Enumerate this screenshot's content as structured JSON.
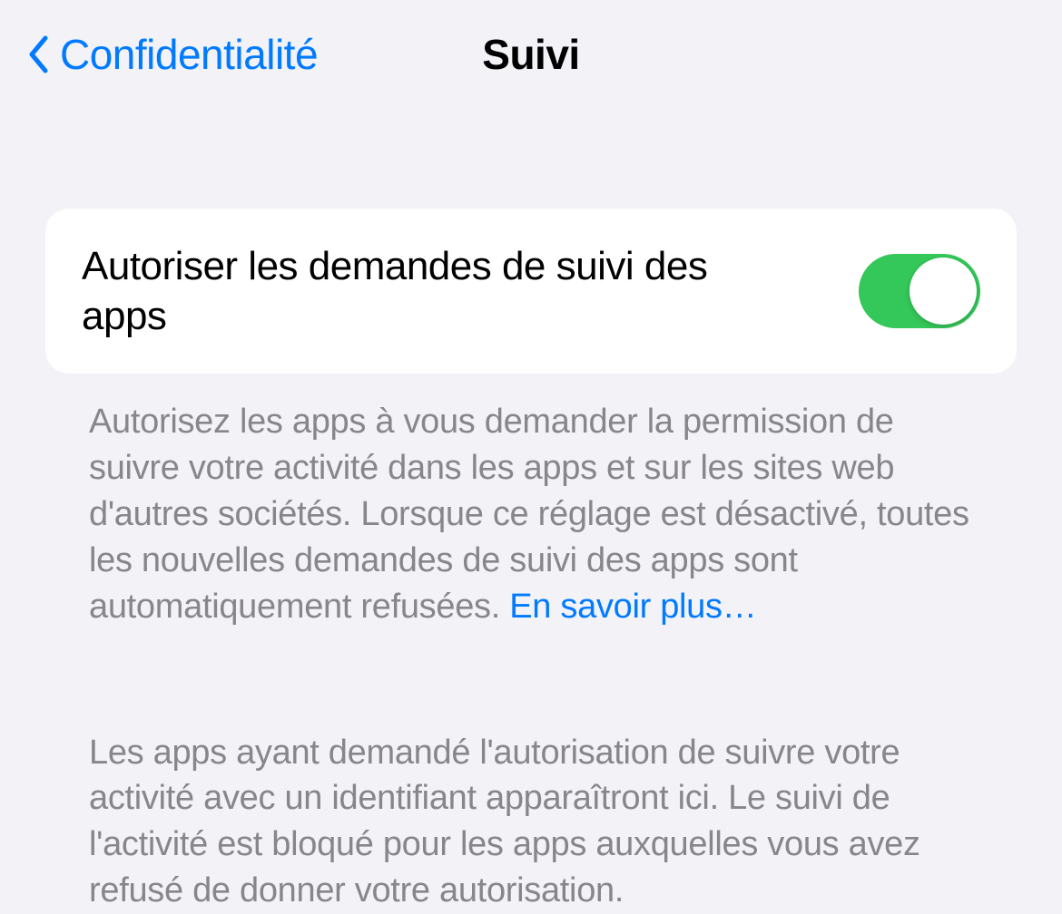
{
  "header": {
    "back_label": "Confidentialité",
    "title": "Suivi"
  },
  "tracking": {
    "toggle_label": "Autoriser les demandes de suivi des apps",
    "toggle_state": "on",
    "description": "Autorisez les apps à vous demander la permission de suivre votre activité dans les apps et sur les sites web d'autres sociétés. Lorsque ce réglage est désactivé, toutes les nouvelles demandes de suivi des apps sont automatiquement refusées. ",
    "learn_more": "En savoir plus…",
    "apps_info": "Les apps ayant demandé l'autorisation de suivre votre activité avec un identifiant apparaîtront ici. Le suivi de l'activité est bloqué pour les apps auxquelles vous avez refusé de donner votre autorisation."
  }
}
